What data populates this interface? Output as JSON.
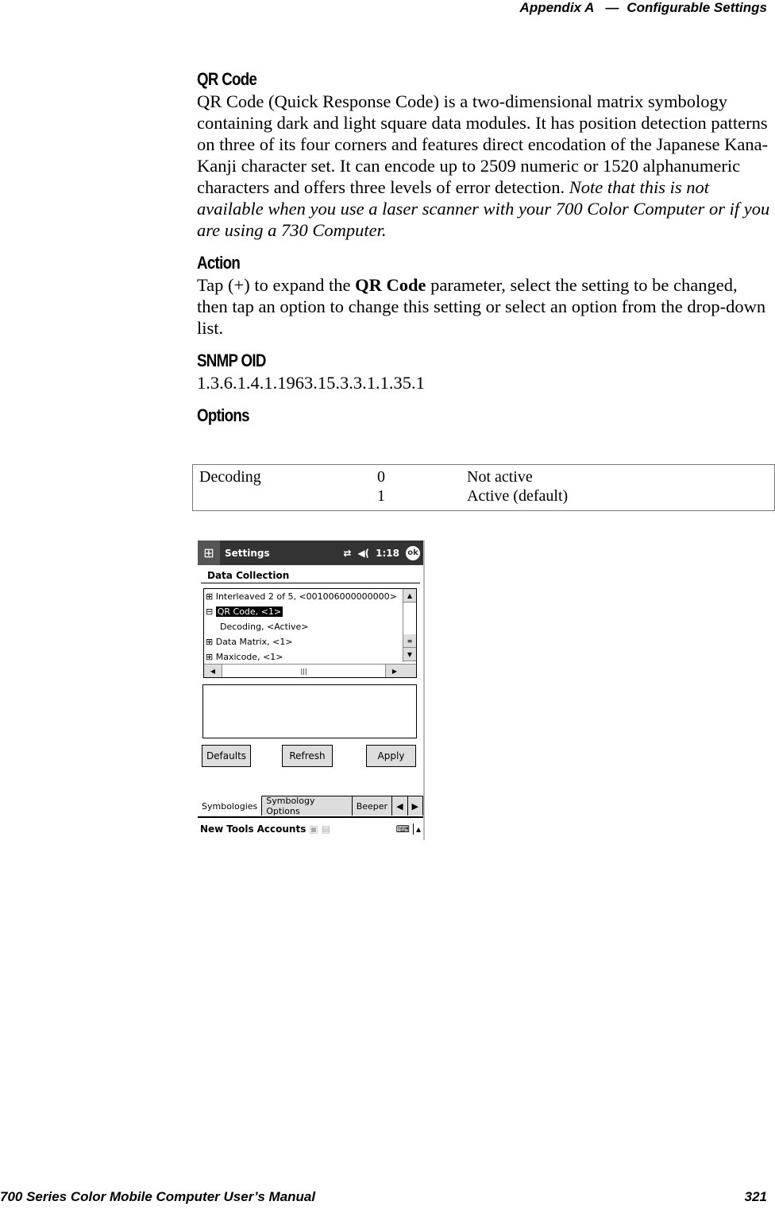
{
  "header": {
    "appendix": "Appendix A",
    "dash": "—",
    "section": "Configurable Settings"
  },
  "footer": {
    "manual": "700 Series Color Mobile Computer User’s Manual",
    "page_number": "321"
  },
  "qr_code": {
    "heading": "QR Code",
    "body": "QR Code (Quick Response Code) is a two-dimensional matrix symbology containing dark and light square data modules. It has position detection patterns on three of its four corners and features direct encodation of the Japanese Kana-Kanji character set. It can encode up to 2509 numeric or 1520 alphanumeric characters and offers three levels of error detection.",
    "note": "Note that this is not available when you use a laser scanner with your 700 Color Computer or if you are using a 730 Computer."
  },
  "action": {
    "heading": "Action",
    "text_before": "Tap (+) to expand the ",
    "bold": "QR Code",
    "text_after": " parameter, select the setting to be changed, then tap an option to change this setting or select an option from the drop-down list."
  },
  "snmp": {
    "heading": "SNMP OID",
    "value": "1.3.6.1.4.1.1963.15.3.3.1.1.35.1"
  },
  "options": {
    "heading": "Options",
    "setting": "Decoding",
    "rows": [
      {
        "value": "0",
        "meaning": "Not active"
      },
      {
        "value": "1",
        "meaning": "Active (default)"
      }
    ]
  },
  "device": {
    "title": "Settings",
    "time": "1:18",
    "ok": "ok",
    "start_icon": "⊞",
    "sync_icon": "⇄",
    "volume_icon": "◀(",
    "section": "Data Collection",
    "tree": [
      {
        "expander": "⊞",
        "label": "Interleaved 2 of 5, <001006000000000>",
        "selected": false
      },
      {
        "expander": "⊟",
        "label": "QR Code, <1>",
        "selected": true
      },
      {
        "expander": "",
        "label": "Decoding, <Active>",
        "selected": false
      },
      {
        "expander": "⊞",
        "label": "Data Matrix, <1>",
        "selected": false
      },
      {
        "expander": "⊞",
        "label": "Maxicode, <1>",
        "selected": false
      }
    ],
    "buttons": {
      "defaults": "Defaults",
      "refresh": "Refresh",
      "apply": "Apply"
    },
    "tabs": [
      "Symbologies",
      "Symbology Options",
      "Beeper"
    ],
    "menu": {
      "new": "New",
      "tools": "Tools",
      "accounts": "Accounts"
    }
  }
}
